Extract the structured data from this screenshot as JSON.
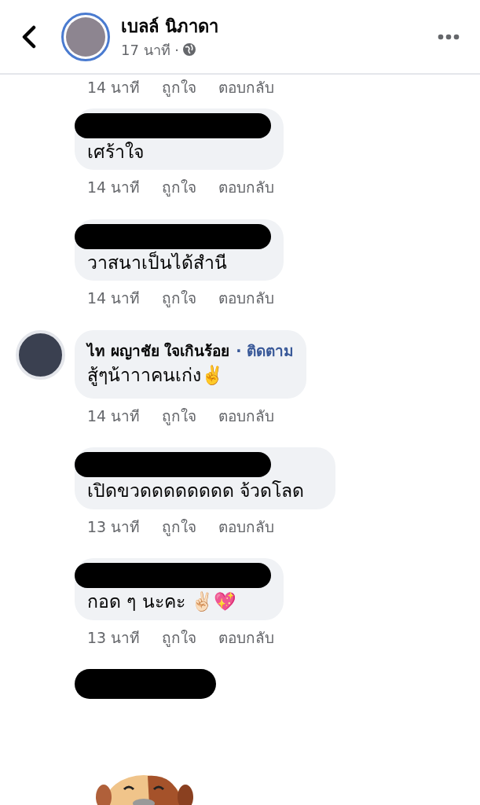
{
  "header": {
    "name": "เบลล์ นิภาดา",
    "time": "17 นาที ·"
  },
  "top_meta": {
    "time": "14 นาที",
    "like": "ถูกใจ",
    "reply": "ตอบกลับ"
  },
  "comments": [
    {
      "kind": "redacted",
      "text": "เศร้าใจ",
      "time": "14 นาที",
      "like": "ถูกใจ",
      "reply": "ตอบกลับ"
    },
    {
      "kind": "redacted",
      "text": "วาสนาเป็นได้สำนี",
      "time": "14 นาที",
      "like": "ถูกใจ",
      "reply": "ตอบกลับ"
    },
    {
      "kind": "named",
      "name": "ไท ผญาชัย ใจเกินร้อย",
      "follow": "· ติดตาม",
      "text": "สู้ๆน้าาาคนเก่ง✌️",
      "time": "14 นาที",
      "like": "ถูกใจ",
      "reply": "ตอบกลับ"
    },
    {
      "kind": "redacted",
      "text": "เปิดขวดดดดดดดด จ้วดโลด",
      "time": "13 นาที",
      "like": "ถูกใจ",
      "reply": "ตอบกลับ"
    },
    {
      "kind": "redacted",
      "text": "กอด ๆ นะคะ ✌🏻💖",
      "time": "13 นาที",
      "like": "ถูกใจ",
      "reply": "ตอบกลับ"
    },
    {
      "kind": "redacted_only"
    }
  ]
}
